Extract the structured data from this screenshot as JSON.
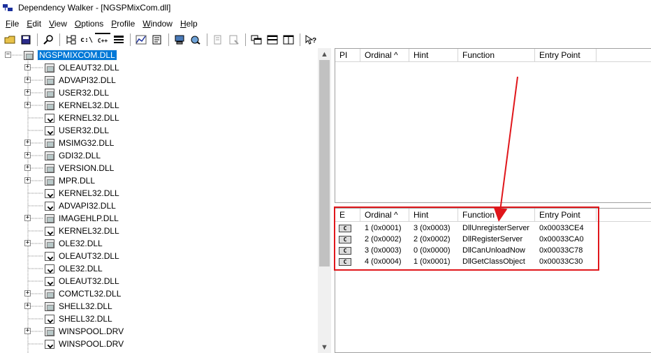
{
  "window": {
    "title": "Dependency Walker - [NGSPMixCom.dll]"
  },
  "menu": [
    {
      "label": "File",
      "accel": "F",
      "rest": "ile"
    },
    {
      "label": "Edit",
      "accel": "E",
      "rest": "dit"
    },
    {
      "label": "View",
      "accel": "V",
      "rest": "iew"
    },
    {
      "label": "Options",
      "accel": "O",
      "rest": "ptions"
    },
    {
      "label": "Profile",
      "accel": "P",
      "rest": "rofile"
    },
    {
      "label": "Window",
      "accel": "W",
      "rest": "indow"
    },
    {
      "label": "Help",
      "accel": "H",
      "rest": "elp"
    }
  ],
  "toolbar": {
    "cpath_label": "c:\\",
    "cpp_label": "C++",
    "help_label": "?"
  },
  "tree": {
    "root": "NGSPMIXCOM.DLL",
    "items": [
      {
        "label": "OLEAUT32.DLL",
        "expandable": true,
        "forwarded": false
      },
      {
        "label": "ADVAPI32.DLL",
        "expandable": true,
        "forwarded": false
      },
      {
        "label": "USER32.DLL",
        "expandable": true,
        "forwarded": false
      },
      {
        "label": "KERNEL32.DLL",
        "expandable": true,
        "forwarded": false
      },
      {
        "label": "KERNEL32.DLL",
        "expandable": false,
        "forwarded": true
      },
      {
        "label": "USER32.DLL",
        "expandable": false,
        "forwarded": true
      },
      {
        "label": "MSIMG32.DLL",
        "expandable": true,
        "forwarded": false
      },
      {
        "label": "GDI32.DLL",
        "expandable": true,
        "forwarded": false
      },
      {
        "label": "VERSION.DLL",
        "expandable": true,
        "forwarded": false
      },
      {
        "label": "MPR.DLL",
        "expandable": true,
        "forwarded": false
      },
      {
        "label": "KERNEL32.DLL",
        "expandable": false,
        "forwarded": true
      },
      {
        "label": "ADVAPI32.DLL",
        "expandable": false,
        "forwarded": true
      },
      {
        "label": "IMAGEHLP.DLL",
        "expandable": true,
        "forwarded": false
      },
      {
        "label": "KERNEL32.DLL",
        "expandable": false,
        "forwarded": true
      },
      {
        "label": "OLE32.DLL",
        "expandable": true,
        "forwarded": false
      },
      {
        "label": "OLEAUT32.DLL",
        "expandable": false,
        "forwarded": true
      },
      {
        "label": "OLE32.DLL",
        "expandable": false,
        "forwarded": true
      },
      {
        "label": "OLEAUT32.DLL",
        "expandable": false,
        "forwarded": true
      },
      {
        "label": "COMCTL32.DLL",
        "expandable": true,
        "forwarded": false
      },
      {
        "label": "SHELL32.DLL",
        "expandable": true,
        "forwarded": false
      },
      {
        "label": "SHELL32.DLL",
        "expandable": false,
        "forwarded": true
      },
      {
        "label": "WINSPOOL.DRV",
        "expandable": true,
        "forwarded": false
      },
      {
        "label": "WINSPOOL.DRV",
        "expandable": false,
        "forwarded": true
      }
    ]
  },
  "imports_pane": {
    "columns": [
      "PI",
      "Ordinal ^",
      "Hint",
      "Function",
      "Entry Point"
    ],
    "rows": []
  },
  "exports_pane": {
    "columns": [
      "E",
      "Ordinal ^",
      "Hint",
      "Function",
      "Entry Point"
    ],
    "rows": [
      {
        "badge": "C",
        "ordinal": "1 (0x0001)",
        "hint": "3 (0x0003)",
        "function": "DllUnregisterServer",
        "entry": "0x00033CE4"
      },
      {
        "badge": "C",
        "ordinal": "2 (0x0002)",
        "hint": "2 (0x0002)",
        "function": "DllRegisterServer",
        "entry": "0x00033CA0"
      },
      {
        "badge": "C",
        "ordinal": "3 (0x0003)",
        "hint": "0 (0x0000)",
        "function": "DllCanUnloadNow",
        "entry": "0x00033C78"
      },
      {
        "badge": "C",
        "ordinal": "4 (0x0004)",
        "hint": "1 (0x0001)",
        "function": "DllGetClassObject",
        "entry": "0x00033C30"
      }
    ]
  },
  "colors": {
    "selection": "#0078d7",
    "annotation": "#e0161b"
  }
}
